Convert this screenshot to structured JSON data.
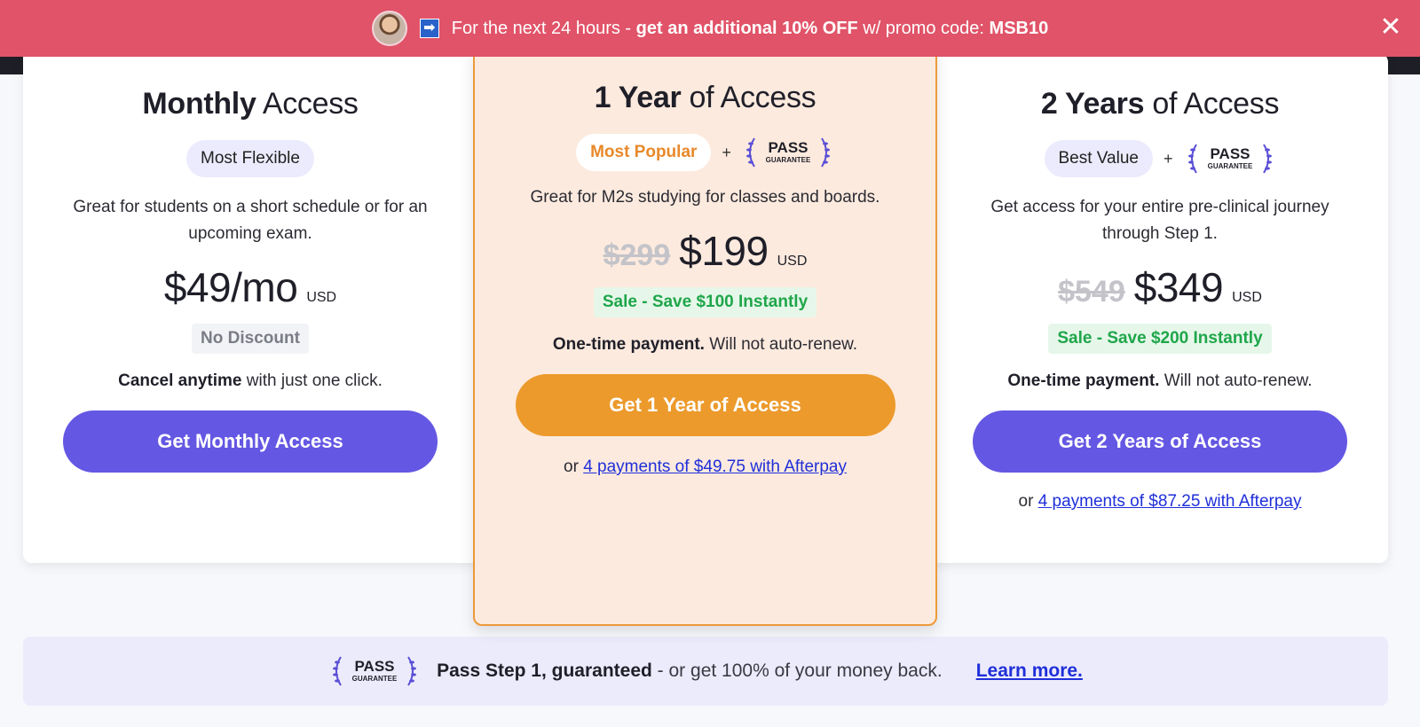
{
  "promo": {
    "arrow_glyph": "➡",
    "text_prefix": "For the next 24 hours - ",
    "text_bold": "get an additional 10% OFF",
    "text_middle": " w/ promo code: ",
    "code": "MSB10",
    "close_glyph": "✕"
  },
  "plans": [
    {
      "title_bold": "Monthly",
      "title_rest": " Access",
      "badge": "Most Flexible",
      "description": "Great for students on a short schedule or for an upcoming exam.",
      "old_price": "",
      "price": "$49/mo",
      "currency": "USD",
      "tag": "No Discount",
      "note_bold": "Cancel anytime",
      "note_rest": " with just one click.",
      "cta": "Get Monthly Access",
      "afterpay_prefix": "",
      "afterpay_link": ""
    },
    {
      "title_bold": "1 Year",
      "title_rest": " of Access",
      "badge": "Most Popular",
      "plus": "+",
      "description": "Great for M2s studying for classes and boards.",
      "old_price": "$299",
      "price": "$199",
      "currency": "USD",
      "tag": "Sale - Save $100 Instantly",
      "note_bold": "One-time payment.",
      "note_rest": " Will not auto-renew.",
      "cta": "Get 1 Year of Access",
      "afterpay_prefix": "or ",
      "afterpay_link": "4 payments of $49.75 with Afterpay"
    },
    {
      "title_bold": "2 Years",
      "title_rest": " of Access",
      "badge": "Best Value",
      "plus": "+",
      "description": "Get access for your entire pre-clinical journey through Step 1.",
      "old_price": "$549",
      "price": "$349",
      "currency": "USD",
      "tag": "Sale - Save $200 Instantly",
      "note_bold": "One-time payment.",
      "note_rest": " Will not auto-renew.",
      "cta": "Get 2 Years of Access",
      "afterpay_prefix": "or ",
      "afterpay_link": "4 payments of $87.25 with Afterpay"
    }
  ],
  "pass_logo": {
    "line1": "PASS",
    "line2": "GUARANTEE"
  },
  "guarantee": {
    "bold": "Pass Step 1, guaranteed",
    "rest": " - or get 100% of your money back.",
    "link": "Learn more."
  },
  "colors": {
    "promo_bg": "#e05368",
    "primary_button": "#6457e3",
    "featured_button": "#ec9a2c",
    "featured_card_bg": "#fdeade",
    "sale_green": "#1fa64a",
    "link_blue": "#1f2fd9"
  }
}
